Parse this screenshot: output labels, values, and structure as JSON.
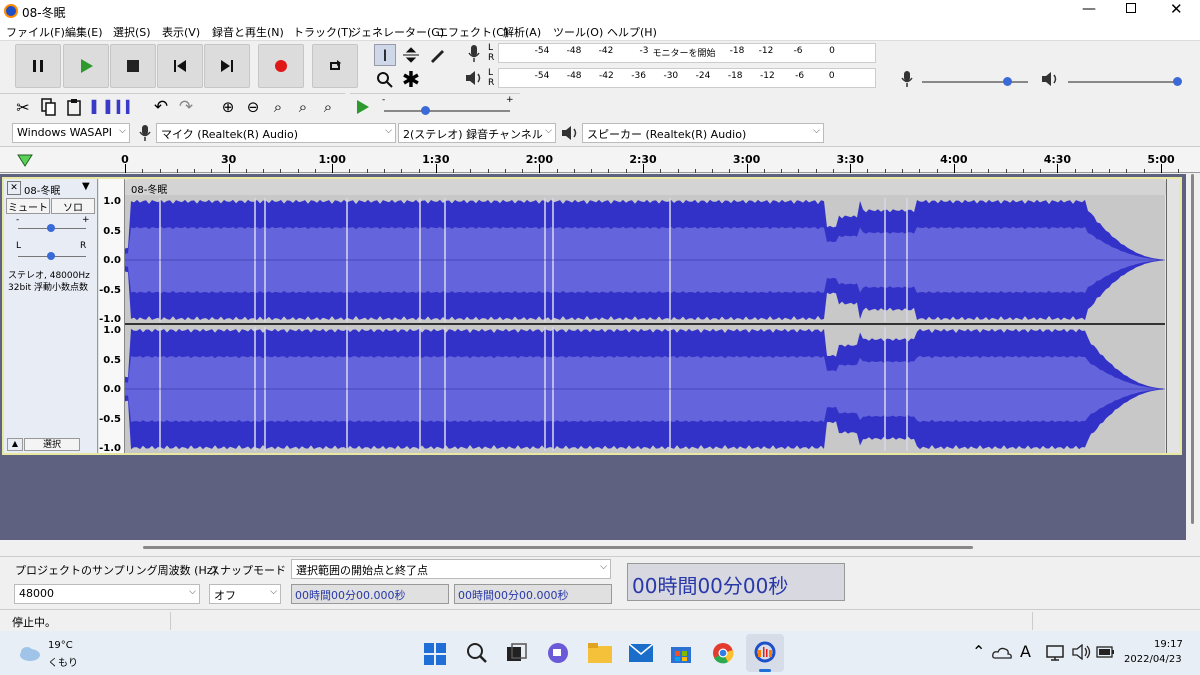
{
  "window": {
    "title": "08-冬眠"
  },
  "menu": [
    "ファイル(F)",
    "編集(E)",
    "選択(S)",
    "表示(V)",
    "録音と再生(N)",
    "トラック(T)",
    "ジェネレーター(G)",
    "エフェクト(C)",
    "解析(A)",
    "ツール(O)",
    "ヘルプ(H)"
  ],
  "meters": {
    "rec_ticks": [
      "-54",
      "-48",
      "-42",
      "-3",
      "モニターを開始",
      "-18",
      "-12",
      "-6",
      "0"
    ],
    "play_ticks": [
      "-54",
      "-48",
      "-42",
      "-36",
      "-30",
      "-24",
      "-18",
      "-12",
      "-6",
      "0"
    ],
    "l": "L",
    "r": "R"
  },
  "devices": {
    "host": "Windows WASAPI",
    "mic": "マイク (Realtek(R) Audio)",
    "channels": "2(ステレオ) 録音チャンネル",
    "speaker": "スピーカー (Realtek(R) Audio)"
  },
  "ruler": [
    "0",
    "30",
    "1:00",
    "1:30",
    "2:00",
    "2:30",
    "3:00",
    "3:30",
    "4:00",
    "4:30",
    "5:00"
  ],
  "track": {
    "name": "08-冬眠",
    "clip": "08-冬眠",
    "mute": "ミュート",
    "solo": "ソロ",
    "info1": "ステレオ, 48000Hz",
    "info2": "32bit 浮動小数点数",
    "select": "選択",
    "pan_l": "L",
    "pan_r": "R",
    "gain_min": "-",
    "gain_max": "+",
    "yaxis": [
      "1.0",
      "0.5",
      "0.0",
      "-0.5",
      "-1.0"
    ]
  },
  "selection_bar": {
    "rate_label": "プロジェクトのサンプリング周波数 (Hz)",
    "rate": "48000",
    "snap_label": "スナップモード",
    "snap": "オフ",
    "sel_label": "選択範囲の開始点と終了点",
    "start": "00時間00分00.000秒",
    "end": "00時間00分00.000秒",
    "time": "00時間00分00秒"
  },
  "status": "停止中。",
  "taskbar": {
    "temp": "19°C",
    "weather": "くもり",
    "time": "19:17",
    "date": "2022/04/23",
    "ime": "A"
  },
  "colors": {
    "wave": "#3232c8",
    "wave_rms": "#6464dc",
    "track_bg": "#c8c8c8",
    "empty": "#5e6180",
    "track_border": "#e8e8a0"
  }
}
